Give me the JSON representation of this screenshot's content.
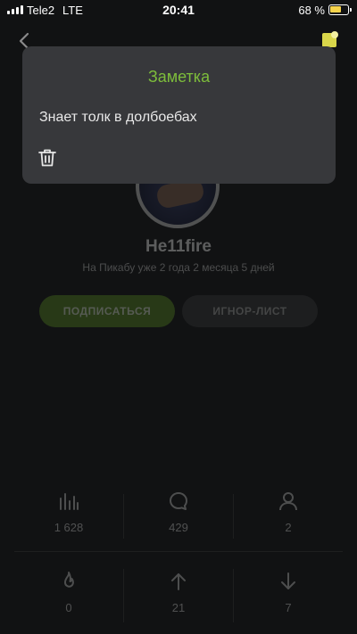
{
  "status_bar": {
    "carrier": "Tele2",
    "network": "LTE",
    "time": "20:41",
    "battery_percent": "68 %",
    "battery_level": 0.68,
    "signal_bars": 4
  },
  "header": {
    "back_icon": "chevron-left-icon",
    "note_icon": "note-icon"
  },
  "profile": {
    "username": "He11fire",
    "member_since": "На Пикабу уже 2 года 2 месяца 5 дней",
    "subscribe_label": "ПОДПИСАТЬСЯ",
    "ignore_label": "ИГНОР-ЛИСТ"
  },
  "stats": [
    {
      "icon": "rating-bars-icon",
      "value": "1 628"
    },
    {
      "icon": "comment-bubble-icon",
      "value": "429"
    },
    {
      "icon": "user-icon",
      "value": "2"
    },
    {
      "icon": "flame-icon",
      "value": "0"
    },
    {
      "icon": "arrow-up-icon",
      "value": "21"
    },
    {
      "icon": "arrow-down-icon",
      "value": "7"
    }
  ],
  "note": {
    "title": "Заметка",
    "text": "Знает толк в долбоебах",
    "delete_icon": "trash-icon"
  },
  "colors": {
    "accent_green": "#7dbd3b",
    "subscribe_bg": "#5b8f25",
    "popup_bg": "#37383b",
    "background": "#111213"
  }
}
